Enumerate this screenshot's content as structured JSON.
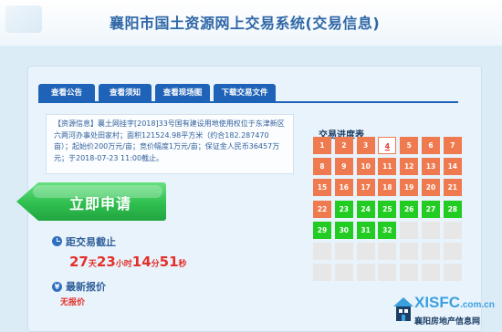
{
  "header": {
    "title": "襄阳市国土资源网上交易系统(交易信息)"
  },
  "tabs": [
    {
      "label": "查看公告"
    },
    {
      "label": "查看须知"
    },
    {
      "label": "查看现场图"
    },
    {
      "label": "下载交易文件"
    }
  ],
  "info": {
    "tag": "【资源信息】",
    "text": "襄土网挂字[2018]33号国有建设用地使用权位于东津新区六两河办事处田家村；面积121524.98平方米（约合182.287470亩）；起始价200万元/亩；竞价幅度1万元/亩；保证金人民币36457万元；于2018-07-23 11:00截止。"
  },
  "apply_button": {
    "label": "立即申请"
  },
  "deadline": {
    "title": "距交易截止",
    "days": "27",
    "days_unit": "天",
    "hours": "23",
    "hours_unit": "小时",
    "minutes": "14",
    "minutes_unit": "分",
    "seconds": "51",
    "seconds_unit": "秒"
  },
  "latest_bid": {
    "title": "最新报价",
    "value": "无报价"
  },
  "progress": {
    "title": "交易进度表",
    "rows": [
      [
        {
          "d": "1",
          "s": "done"
        },
        {
          "d": "2",
          "s": "done"
        },
        {
          "d": "3",
          "s": "done"
        },
        {
          "d": "4",
          "s": "today"
        },
        {
          "d": "5",
          "s": "done"
        },
        {
          "d": "6",
          "s": "done"
        },
        {
          "d": "7",
          "s": "done"
        }
      ],
      [
        {
          "d": "8",
          "s": "done"
        },
        {
          "d": "9",
          "s": "done"
        },
        {
          "d": "10",
          "s": "done"
        },
        {
          "d": "11",
          "s": "done"
        },
        {
          "d": "12",
          "s": "done"
        },
        {
          "d": "13",
          "s": "done"
        },
        {
          "d": "14",
          "s": "done"
        }
      ],
      [
        {
          "d": "15",
          "s": "done"
        },
        {
          "d": "16",
          "s": "done"
        },
        {
          "d": "17",
          "s": "done"
        },
        {
          "d": "18",
          "s": "done"
        },
        {
          "d": "19",
          "s": "done"
        },
        {
          "d": "20",
          "s": "done"
        },
        {
          "d": "21",
          "s": "done"
        }
      ],
      [
        {
          "d": "22",
          "s": "cur"
        },
        {
          "d": "23",
          "s": "active"
        },
        {
          "d": "24",
          "s": "active"
        },
        {
          "d": "25",
          "s": "active"
        },
        {
          "d": "26",
          "s": "active"
        },
        {
          "d": "27",
          "s": "active"
        },
        {
          "d": "28",
          "s": "active"
        }
      ],
      [
        {
          "d": "29",
          "s": "active"
        },
        {
          "d": "30",
          "s": "active"
        },
        {
          "d": "31",
          "s": "active"
        },
        {
          "d": "32",
          "s": "active"
        },
        {
          "d": "",
          "s": "empty"
        },
        {
          "d": "",
          "s": "empty"
        },
        {
          "d": "",
          "s": "empty"
        }
      ],
      [
        {
          "d": "",
          "s": "empty"
        },
        {
          "d": "",
          "s": "empty"
        },
        {
          "d": "",
          "s": "empty"
        },
        {
          "d": "",
          "s": "empty"
        },
        {
          "d": "",
          "s": "empty"
        },
        {
          "d": "",
          "s": "empty"
        },
        {
          "d": "",
          "s": "empty"
        }
      ],
      [
        {
          "d": "",
          "s": "empty"
        },
        {
          "d": "",
          "s": "empty"
        },
        {
          "d": "",
          "s": "empty"
        },
        {
          "d": "",
          "s": "empty"
        },
        {
          "d": "",
          "s": "empty"
        },
        {
          "d": "",
          "s": "empty"
        },
        {
          "d": "",
          "s": "empty"
        }
      ]
    ]
  },
  "watermark": {
    "brand": "XISFC",
    "domain": ".com.cn",
    "subtitle": "襄阳房地产信息网"
  },
  "colors": {
    "accent": "#1f63b8",
    "done": "#f07a4f",
    "active": "#22cc22",
    "alert": "#e4302b"
  },
  "icons": {
    "deadline": "clock-icon",
    "bid": "yen-icon"
  }
}
